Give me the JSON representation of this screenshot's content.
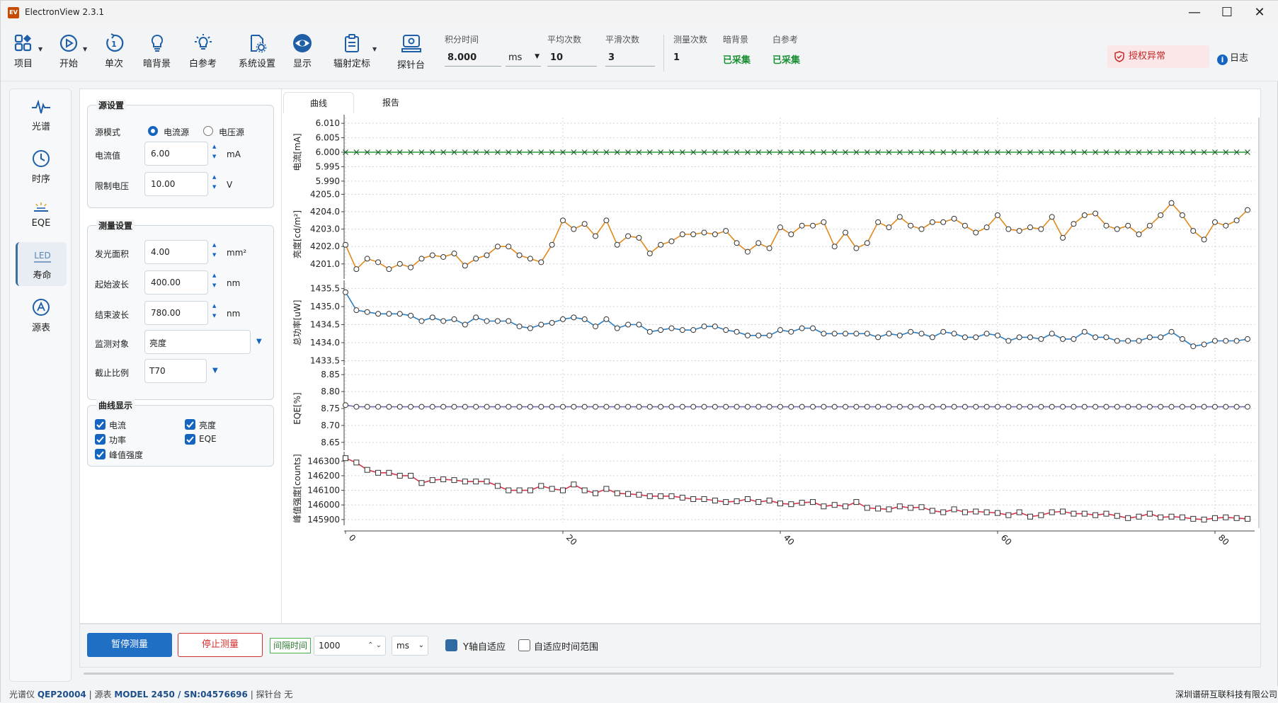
{
  "window": {
    "title": "ElectronView 2.3.1",
    "icon_text": "EV"
  },
  "toolbar": {
    "items": [
      {
        "label": "项目",
        "icon": "project-icon"
      },
      {
        "label": "开始",
        "icon": "play-icon"
      },
      {
        "label": "单次",
        "icon": "single-icon"
      },
      {
        "label": "暗背景",
        "icon": "bulb-icon"
      },
      {
        "label": "白参考",
        "icon": "bulb-ray-icon"
      },
      {
        "label": "系统设置",
        "icon": "settings-icon"
      },
      {
        "label": "显示",
        "icon": "eye-icon"
      },
      {
        "label": "辐射定标",
        "icon": "clipboard-icon"
      },
      {
        "label": "探针台",
        "icon": "probe-icon"
      }
    ],
    "params": {
      "integration_time": {
        "label": "积分时间",
        "value": "8.000",
        "unit": "ms"
      },
      "avg_count": {
        "label": "平均次数",
        "value": "10"
      },
      "smooth_count": {
        "label": "平滑次数",
        "value": "3"
      },
      "measure_count": {
        "label": "测量次数",
        "value": "1"
      },
      "dark_bg": {
        "label": "暗背景",
        "value": "已采集"
      },
      "white_ref": {
        "label": "白参考",
        "value": "已采集"
      }
    },
    "license": "授权异常",
    "log": "日志",
    "accent": "#1565c0"
  },
  "nav": {
    "items": [
      {
        "label": "光谱",
        "icon": "spectrum-icon"
      },
      {
        "label": "时序",
        "icon": "clock-icon"
      },
      {
        "label": "EQE",
        "icon": "eqe-icon"
      },
      {
        "label": "寿命",
        "icon": "led-icon",
        "icon_text": "LED",
        "active": true
      },
      {
        "label": "源表",
        "icon": "meter-icon"
      }
    ]
  },
  "settings": {
    "source": {
      "title": "源设置",
      "mode_label": "源模式",
      "mode_current": "电流源",
      "mode_voltage": "电压源",
      "current_label": "电流值",
      "current_value": "6.00",
      "current_unit": "mA",
      "vlimit_label": "限制电压",
      "vlimit_value": "10.00",
      "vlimit_unit": "V"
    },
    "measure": {
      "title": "测量设置",
      "area_label": "发光面积",
      "area_value": "4.00",
      "area_unit": "mm²",
      "start_label": "起始波长",
      "start_value": "400.00",
      "start_unit": "nm",
      "end_label": "结束波长",
      "end_value": "780.00",
      "end_unit": "nm",
      "monitor_label": "监测对象",
      "monitor_value": "亮度",
      "cutoff_label": "截止比例",
      "cutoff_value": "T70"
    },
    "curves": {
      "title": "曲线显示",
      "items": [
        "电流",
        "亮度",
        "功率",
        "EQE",
        "峰值强度"
      ]
    }
  },
  "tabs": [
    "曲线",
    "报告"
  ],
  "chart_data": [
    {
      "type": "line",
      "ylabel": "电流[mA]",
      "ylim": [
        5.988,
        6.012
      ],
      "yticks": [
        "6.010",
        "6.005",
        "6.000",
        "5.995",
        "5.990"
      ],
      "ytick_values": [
        6.01,
        6.005,
        6.0,
        5.995,
        5.99
      ],
      "color": "#2a9d3a",
      "marker": "x",
      "series": [
        {
          "values": [
            6.0,
            6.0,
            6.0,
            6.0,
            6.0,
            6.0,
            6.0,
            6.0,
            6.0,
            6.0,
            6.0,
            6.0,
            6.0,
            6.0,
            6.0,
            6.0,
            6.0,
            6.0,
            6.0,
            6.0,
            6.0,
            6.0,
            6.0,
            6.0,
            6.0,
            6.0,
            6.0,
            6.0,
            6.0,
            6.0,
            6.0,
            6.0,
            6.0,
            6.0,
            6.0,
            6.0,
            6.0,
            6.0,
            6.0,
            6.0,
            6.0,
            6.0,
            6.0,
            6.0,
            6.0,
            6.0,
            6.0,
            6.0,
            6.0,
            6.0,
            6.0,
            6.0,
            6.0,
            6.0,
            6.0,
            6.0,
            6.0,
            6.0,
            6.0,
            6.0,
            6.0,
            6.0,
            6.0,
            6.0,
            6.0,
            6.0,
            6.0,
            6.0,
            6.0,
            6.0,
            6.0,
            6.0,
            6.0,
            6.0,
            6.0,
            6.0,
            6.0,
            6.0,
            6.0,
            6.0,
            6.0,
            6.0,
            6.0,
            6.0
          ]
        }
      ]
    },
    {
      "type": "line",
      "ylabel": "亮度[cd/m²]",
      "ylim": [
        4200.3,
        4205.1
      ],
      "yticks": [
        "4205.0",
        "4204.0",
        "4203.0",
        "4202.0",
        "4201.0"
      ],
      "ytick_values": [
        4205.0,
        4204.0,
        4203.0,
        4202.0,
        4201.0
      ],
      "color": "#e08a1e",
      "marker": "o",
      "series": [
        {
          "values": [
            4202.1,
            4200.7,
            4201.3,
            4201.1,
            4200.7,
            4201.0,
            4200.8,
            4201.3,
            4201.5,
            4201.4,
            4201.6,
            4200.9,
            4201.3,
            4201.5,
            4202.0,
            4202.0,
            4201.5,
            4201.3,
            4201.1,
            4202.1,
            4203.5,
            4203.0,
            4203.3,
            4202.6,
            4203.5,
            4202.1,
            4202.6,
            4202.5,
            4201.6,
            4202.1,
            4202.3,
            4202.7,
            4202.7,
            4202.8,
            4202.7,
            4202.9,
            4202.2,
            4201.7,
            4202.2,
            4201.9,
            4203.1,
            4202.7,
            4203.2,
            4203.2,
            4203.4,
            4202.0,
            4202.8,
            4201.9,
            4202.2,
            4203.4,
            4203.1,
            4203.7,
            4203.2,
            4203.0,
            4203.4,
            4203.4,
            4203.6,
            4203.2,
            4202.8,
            4203.1,
            4203.8,
            4203.0,
            4202.9,
            4203.1,
            4203.0,
            4203.7,
            4202.5,
            4203.3,
            4203.8,
            4203.9,
            4203.2,
            4203.0,
            4203.2,
            4202.7,
            4203.2,
            4203.8,
            4204.5,
            4203.8,
            4202.9,
            4202.4,
            4203.4,
            4203.2,
            4203.5,
            4204.1
          ]
        }
      ]
    },
    {
      "type": "line",
      "ylabel": "总功率[uW]",
      "ylim": [
        1433.45,
        1435.65
      ],
      "yticks": [
        "1435.5",
        "1435.0",
        "1434.5",
        "1434.0",
        "1433.5"
      ],
      "ytick_values": [
        1435.5,
        1435.0,
        1434.5,
        1434.0,
        1433.5
      ],
      "color": "#2d7fc4",
      "marker": "o",
      "series": [
        {
          "values": [
            1435.4,
            1434.9,
            1434.85,
            1434.8,
            1434.8,
            1434.8,
            1434.75,
            1434.6,
            1434.7,
            1434.6,
            1434.65,
            1434.5,
            1434.7,
            1434.6,
            1434.6,
            1434.6,
            1434.45,
            1434.4,
            1434.5,
            1434.55,
            1434.65,
            1434.7,
            1434.65,
            1434.45,
            1434.65,
            1434.4,
            1434.5,
            1434.5,
            1434.3,
            1434.35,
            1434.4,
            1434.35,
            1434.35,
            1434.45,
            1434.45,
            1434.35,
            1434.3,
            1434.2,
            1434.2,
            1434.2,
            1434.35,
            1434.3,
            1434.4,
            1434.4,
            1434.25,
            1434.25,
            1434.25,
            1434.25,
            1434.25,
            1434.15,
            1434.25,
            1434.2,
            1434.3,
            1434.25,
            1434.15,
            1434.3,
            1434.25,
            1434.15,
            1434.15,
            1434.25,
            1434.2,
            1434.05,
            1434.15,
            1434.15,
            1434.1,
            1434.25,
            1434.1,
            1434.1,
            1434.3,
            1434.15,
            1434.15,
            1434.05,
            1434.05,
            1434.05,
            1434.15,
            1434.15,
            1434.3,
            1434.1,
            1433.9,
            1433.95,
            1434.05,
            1434.05,
            1434.05,
            1434.1
          ]
        }
      ]
    },
    {
      "type": "line",
      "ylabel": "EQE[%]",
      "ylim": [
        8.635,
        8.865
      ],
      "yticks": [
        "8.85",
        "8.80",
        "8.75",
        "8.70",
        "8.65"
      ],
      "ytick_values": [
        8.85,
        8.8,
        8.75,
        8.7,
        8.65
      ],
      "color": "#6f6fb0",
      "marker": "o",
      "series": [
        {
          "values": [
            8.76,
            8.755,
            8.755,
            8.755,
            8.755,
            8.755,
            8.755,
            8.755,
            8.755,
            8.755,
            8.755,
            8.755,
            8.755,
            8.755,
            8.755,
            8.755,
            8.755,
            8.755,
            8.755,
            8.755,
            8.755,
            8.755,
            8.755,
            8.755,
            8.755,
            8.755,
            8.755,
            8.755,
            8.755,
            8.755,
            8.755,
            8.755,
            8.755,
            8.755,
            8.755,
            8.755,
            8.755,
            8.755,
            8.755,
            8.755,
            8.755,
            8.755,
            8.755,
            8.755,
            8.755,
            8.755,
            8.755,
            8.755,
            8.755,
            8.755,
            8.755,
            8.755,
            8.755,
            8.755,
            8.755,
            8.755,
            8.755,
            8.755,
            8.755,
            8.755,
            8.755,
            8.755,
            8.755,
            8.755,
            8.755,
            8.755,
            8.755,
            8.755,
            8.755,
            8.755,
            8.755,
            8.755,
            8.755,
            8.755,
            8.755,
            8.755,
            8.755,
            8.755,
            8.755,
            8.755,
            8.755,
            8.755,
            8.755,
            8.755
          ]
        }
      ]
    },
    {
      "type": "line",
      "ylabel": "峰值强度[counts]",
      "ylim": [
        145880,
        146345
      ],
      "yticks": [
        "146300",
        "146200",
        "146100",
        "146000",
        "145900"
      ],
      "ytick_values": [
        146300,
        146200,
        146100,
        146000,
        145900
      ],
      "color": "#d8344a",
      "marker": "s",
      "xticks": [
        "0",
        "20",
        "40",
        "60",
        "80"
      ],
      "xtick_values": [
        0,
        20,
        40,
        60,
        80
      ],
      "xlim": [
        0,
        83
      ],
      "series": [
        {
          "values": [
            146320,
            146290,
            146240,
            146220,
            146220,
            146200,
            146200,
            146150,
            146170,
            146175,
            146170,
            146160,
            146160,
            146160,
            146130,
            146100,
            146100,
            146100,
            146130,
            146110,
            146100,
            146140,
            146100,
            146080,
            146110,
            146080,
            146075,
            146070,
            146060,
            146060,
            146060,
            146050,
            146040,
            146040,
            146030,
            146020,
            146025,
            146040,
            146020,
            146030,
            146010,
            146005,
            146015,
            146020,
            145990,
            146000,
            145990,
            146020,
            145980,
            145975,
            145970,
            145990,
            145980,
            145985,
            145960,
            145950,
            145970,
            145950,
            145955,
            145950,
            145945,
            145930,
            145950,
            145920,
            145930,
            145950,
            145955,
            145940,
            145940,
            145930,
            145940,
            145925,
            145910,
            145920,
            145940,
            145915,
            145920,
            145915,
            145905,
            145900,
            145910,
            145915,
            145910,
            145905
          ]
        }
      ]
    }
  ],
  "bottom": {
    "pause": "暂停测量",
    "stop": "停止测量",
    "interval_label": "间隔时间",
    "interval_value": "1000",
    "interval_unit": "ms",
    "y_auto": "Y轴自适应",
    "time_auto": "自适应时间范围"
  },
  "status": {
    "spectrometer_label": "光谱仪",
    "spectrometer": "QEP20004",
    "source_label": "源表",
    "source": "MODEL 2450 / SN:04576696",
    "probe_label": "探针台",
    "probe": "无",
    "company": "深圳谱研互联科技有限公司"
  }
}
